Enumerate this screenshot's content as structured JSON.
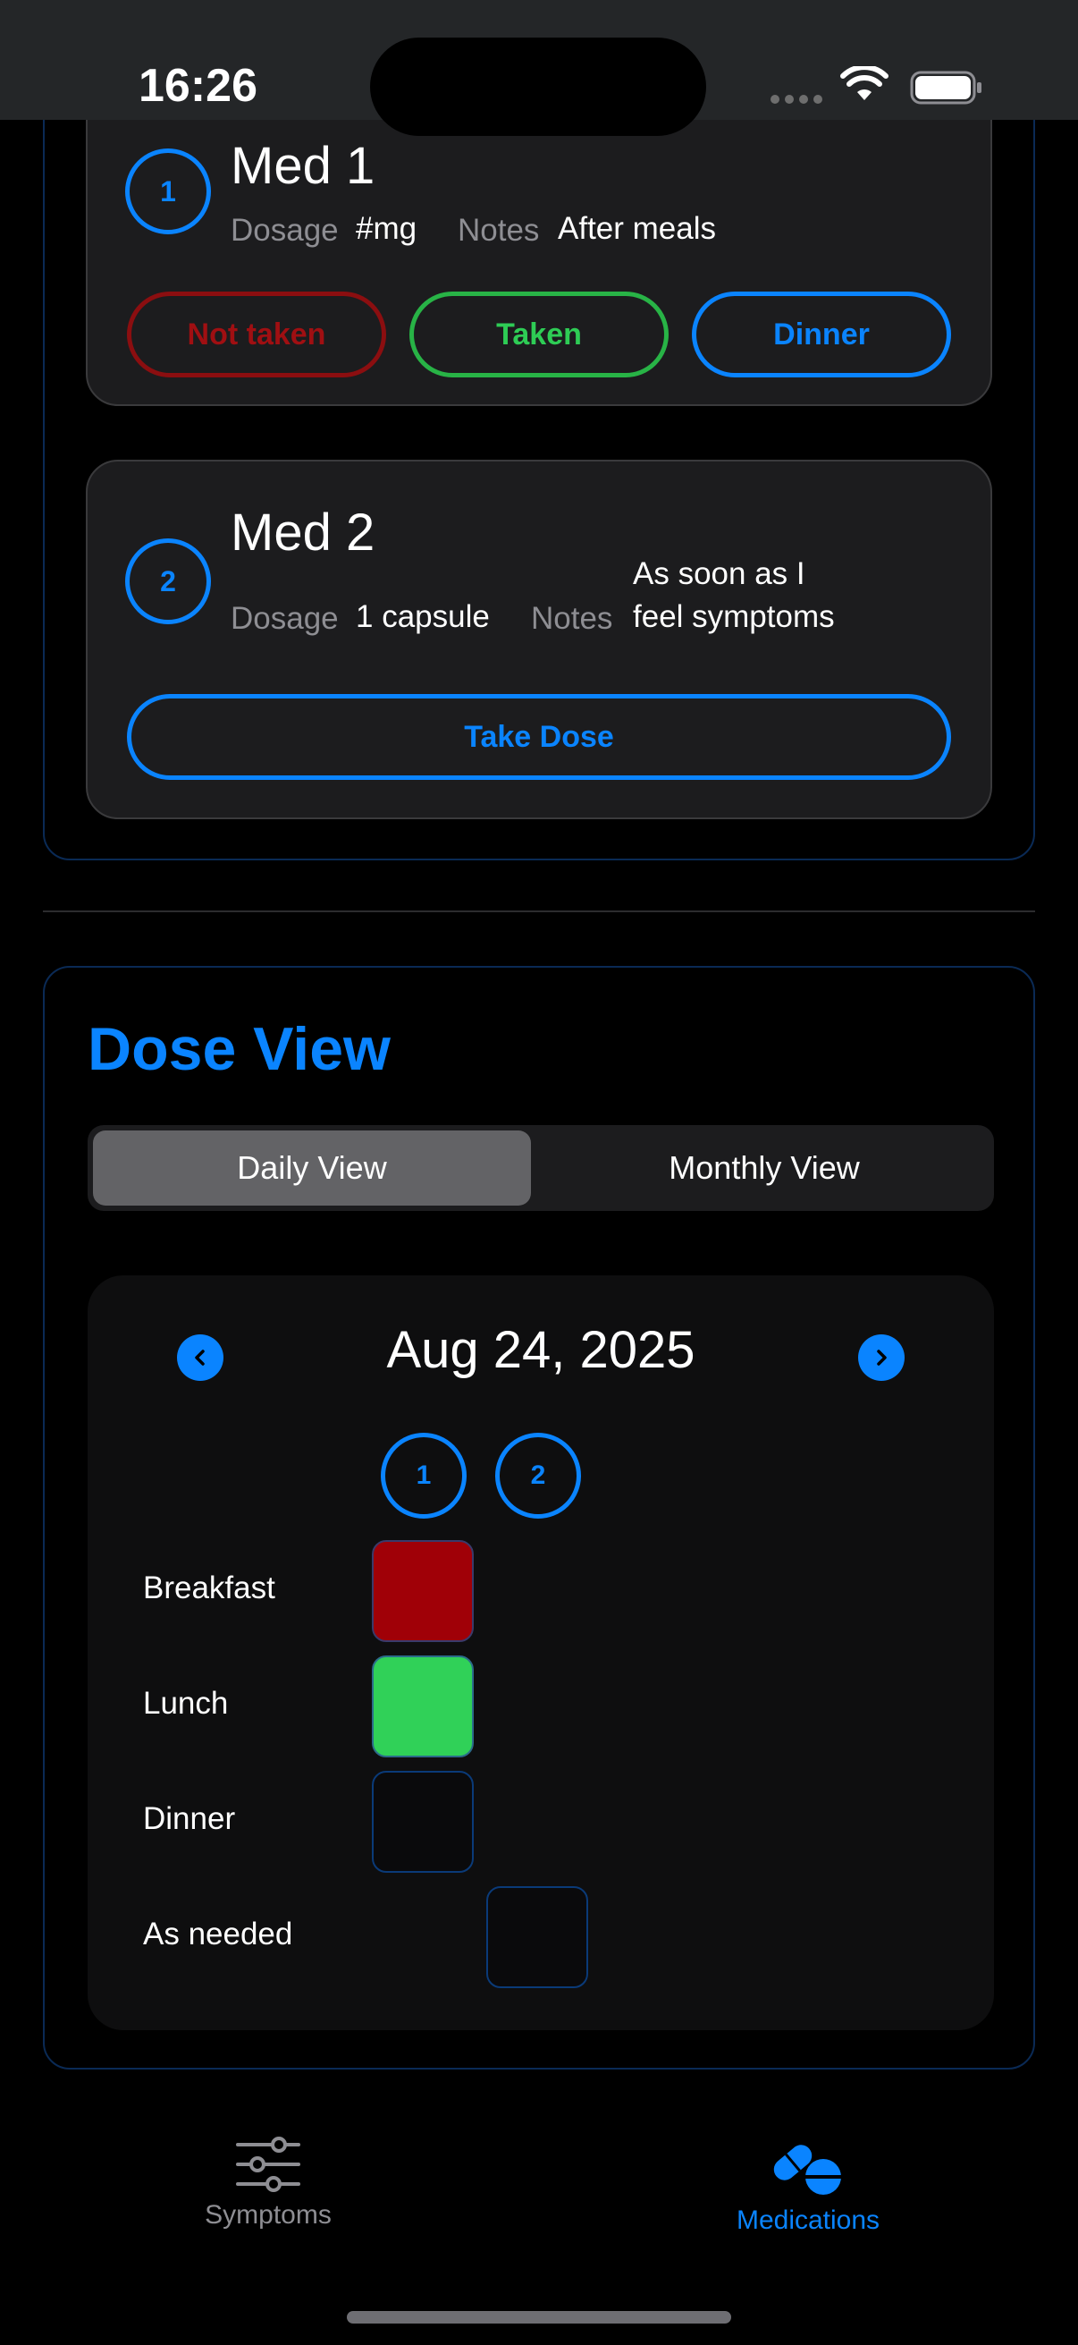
{
  "status_bar": {
    "time": "16:26"
  },
  "medications": [
    {
      "number": "1",
      "name": "Med 1",
      "dosage_label": "Dosage",
      "dosage_value": "#mg",
      "notes_label": "Notes",
      "notes_value": "After meals",
      "actions": [
        "Not taken",
        "Taken",
        "Dinner"
      ]
    },
    {
      "number": "2",
      "name": "Med 2",
      "dosage_label": "Dosage",
      "dosage_value": "1 capsule",
      "notes_label": "Notes",
      "notes_line1": "As soon as I",
      "notes_line2": "feel symptoms",
      "action": "Take Dose"
    }
  ],
  "dose_view": {
    "title": "Dose View",
    "segments": [
      "Daily View",
      "Monthly View"
    ],
    "selected_segment": "Daily View",
    "date": "Aug 24, 2025",
    "columns": [
      "1",
      "2"
    ],
    "rows": [
      "Breakfast",
      "Lunch",
      "Dinner",
      "As needed"
    ],
    "cell_states": {
      "breakfast_med1": "not-taken",
      "lunch_med1": "taken",
      "dinner_med1": "pending",
      "as_needed_med2": "pending"
    }
  },
  "tab_bar": {
    "tabs": [
      "Symptoms",
      "Medications"
    ],
    "active": "Medications"
  },
  "colors": {
    "accent": "#0a84ff",
    "not_taken": "#a00007",
    "taken": "#30d158",
    "inactive_tab": "#8e8e93"
  },
  "icons": {
    "status": [
      "wifi-icon",
      "battery-icon"
    ],
    "nav": [
      "chevron-left-icon",
      "chevron-right-icon"
    ],
    "tabs": [
      "sliders-icon",
      "pills-icon"
    ]
  }
}
